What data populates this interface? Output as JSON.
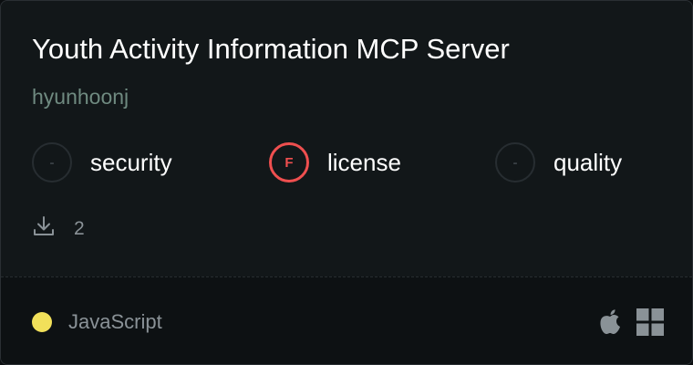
{
  "server": {
    "title": "Youth Activity Information MCP Server",
    "author": "hyunhoonj"
  },
  "scores": [
    {
      "grade": "-",
      "label": "security"
    },
    {
      "grade": "F",
      "label": "license"
    },
    {
      "grade": "-",
      "label": "quality"
    }
  ],
  "downloads": {
    "icon": "download-icon",
    "count": "2"
  },
  "footer": {
    "language": "JavaScript",
    "language_color": "#f1e05a",
    "platforms": [
      "apple-icon",
      "windows-icon"
    ]
  },
  "colors": {
    "fail": "#ef4f4f",
    "title": "#ffffff",
    "author": "#6f8a80"
  }
}
